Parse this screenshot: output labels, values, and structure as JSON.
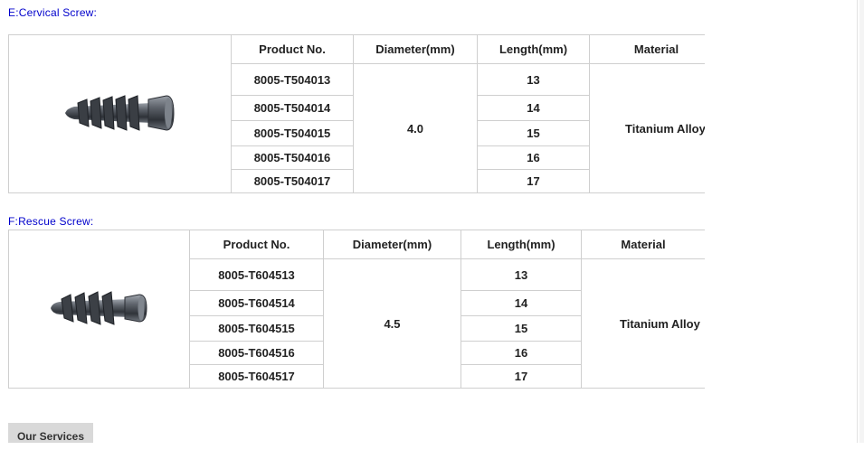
{
  "section_e": {
    "title": "E:Cervical Screw:",
    "headers": {
      "product": "Product No.",
      "diameter": "Diameter(mm)",
      "length": "Length(mm)",
      "material": "Material"
    },
    "rows": [
      {
        "product": "8005-T504013",
        "length": "13"
      },
      {
        "product": "8005-T504014",
        "length": "14"
      },
      {
        "product": "8005-T504015",
        "length": "15"
      },
      {
        "product": "8005-T504016",
        "length": "16"
      },
      {
        "product": "8005-T504017",
        "length": "17"
      }
    ],
    "diameter": "4.0",
    "material": "Titanium Alloy"
  },
  "section_f": {
    "title": "F:Rescue Screw:",
    "headers": {
      "product": "Product No.",
      "diameter": "Diameter(mm)",
      "length": "Length(mm)",
      "material": "Material"
    },
    "rows": [
      {
        "product": "8005-T604513",
        "length": "13"
      },
      {
        "product": "8005-T604514",
        "length": "14"
      },
      {
        "product": "8005-T604515",
        "length": "15"
      },
      {
        "product": "8005-T604516",
        "length": "16"
      },
      {
        "product": "8005-T604517",
        "length": "17"
      }
    ],
    "diameter": "4.5",
    "material": "Titanium Alloy"
  },
  "footer": {
    "services_label": "Our Services"
  },
  "colors": {
    "section_title": "#0000cc",
    "border": "#cfcfcf",
    "tab_bg": "#d9d9d9"
  }
}
